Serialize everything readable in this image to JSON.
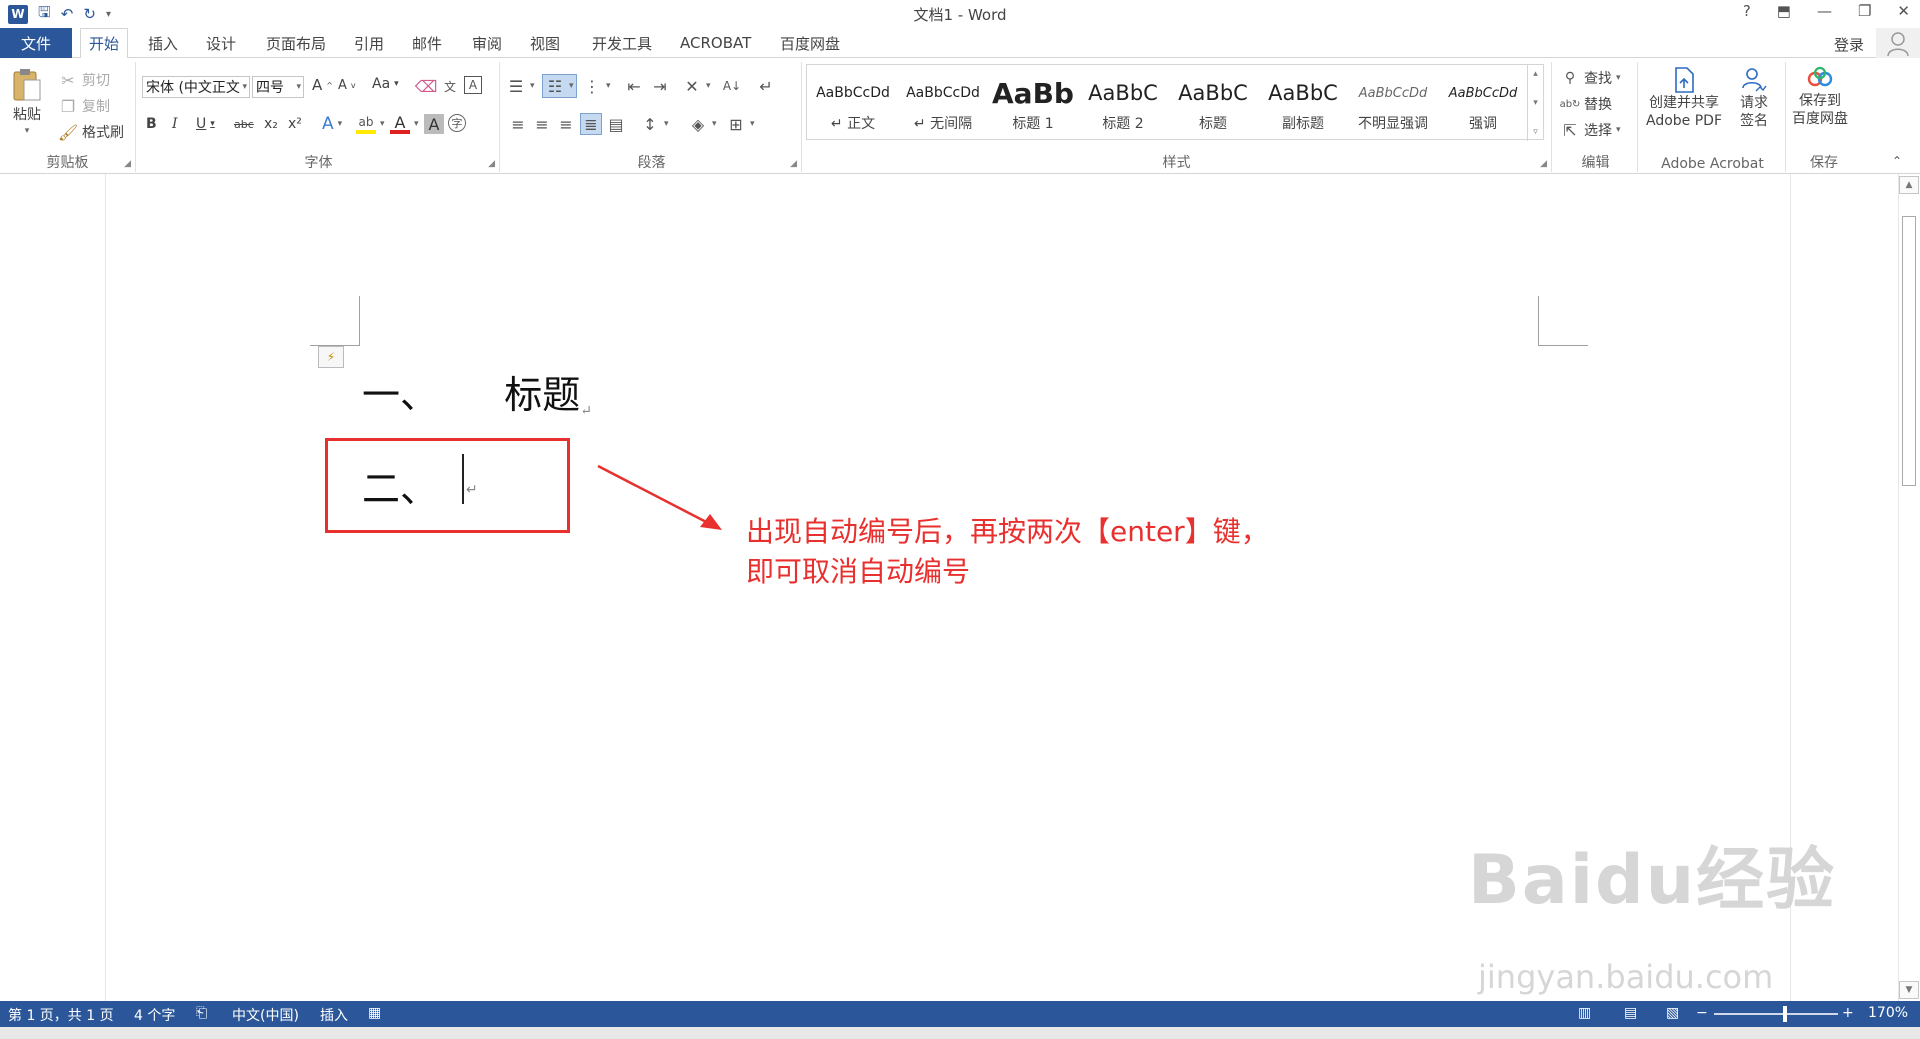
{
  "window": {
    "title": "文档1 - Word",
    "help": "?",
    "ribbon_display": "⬒",
    "minimize": "—",
    "restore": "❐",
    "close": "✕"
  },
  "qat": {
    "word_logo": "W",
    "save": "🖫",
    "undo": "↶",
    "redo": "↻",
    "customize": "▾"
  },
  "tabs": {
    "file": "文件",
    "items": [
      "开始",
      "插入",
      "设计",
      "页面布局",
      "引用",
      "邮件",
      "审阅",
      "视图",
      "开发工具",
      "ACROBAT",
      "百度网盘"
    ],
    "active": "开始",
    "login": "登录"
  },
  "ribbon": {
    "clipboard": {
      "paste": "粘贴",
      "cut": "剪切",
      "copy": "复制",
      "format_painter": "格式刷",
      "label": "剪贴板"
    },
    "font": {
      "font_name": "宋体 (中文正文",
      "font_size": "四号",
      "grow": "A",
      "shrink": "A",
      "change_case": "Aa",
      "bold": "B",
      "italic": "I",
      "underline": "U",
      "strikethrough": "abc",
      "subscript": "x₂",
      "superscript": "x²",
      "label": "字体"
    },
    "paragraph": {
      "label": "段落"
    },
    "styles": {
      "label": "样式",
      "items": [
        {
          "sample": "AaBbCcDd",
          "name": "↵ 正文"
        },
        {
          "sample": "AaBbCcDd",
          "name": "↵ 无间隔"
        },
        {
          "sample": "AaBb",
          "name": "标题 1"
        },
        {
          "sample": "AaBbC",
          "name": "标题 2"
        },
        {
          "sample": "AaBbC",
          "name": "标题"
        },
        {
          "sample": "AaBbC",
          "name": "副标题"
        },
        {
          "sample": "AaBbCcDd",
          "name": "不明显强调"
        },
        {
          "sample": "AaBbCcDd",
          "name": "强调"
        }
      ]
    },
    "editing": {
      "find": "查找",
      "replace": "替换",
      "select": "选择",
      "label": "编辑"
    },
    "acrobat": {
      "create_line1": "创建并共享",
      "create_line2": "Adobe PDF",
      "request_line1": "请求",
      "request_line2": "签名",
      "label": "Adobe Acrobat"
    },
    "save": {
      "line1": "保存到",
      "line2": "百度网盘",
      "label": "保存"
    }
  },
  "document": {
    "line1_number": "一、",
    "line1_text": "标题",
    "line2_number": "二、",
    "pilcrow": "↵",
    "annotation_line1": "出现自动编号后，再按两次【enter】键，",
    "annotation_line2": "即可取消自动编号",
    "watermark": "Baidu经验",
    "watermark_url": "jingyan.baidu.com"
  },
  "statusbar": {
    "page": "第 1 页，共 1 页",
    "words": "4 个字",
    "language": "中文(中国)",
    "mode": "插入",
    "zoom": "170%",
    "zoom_minus": "−",
    "zoom_plus": "+"
  },
  "colors": {
    "accent": "#2b579a",
    "annotation": "#e8312f"
  }
}
